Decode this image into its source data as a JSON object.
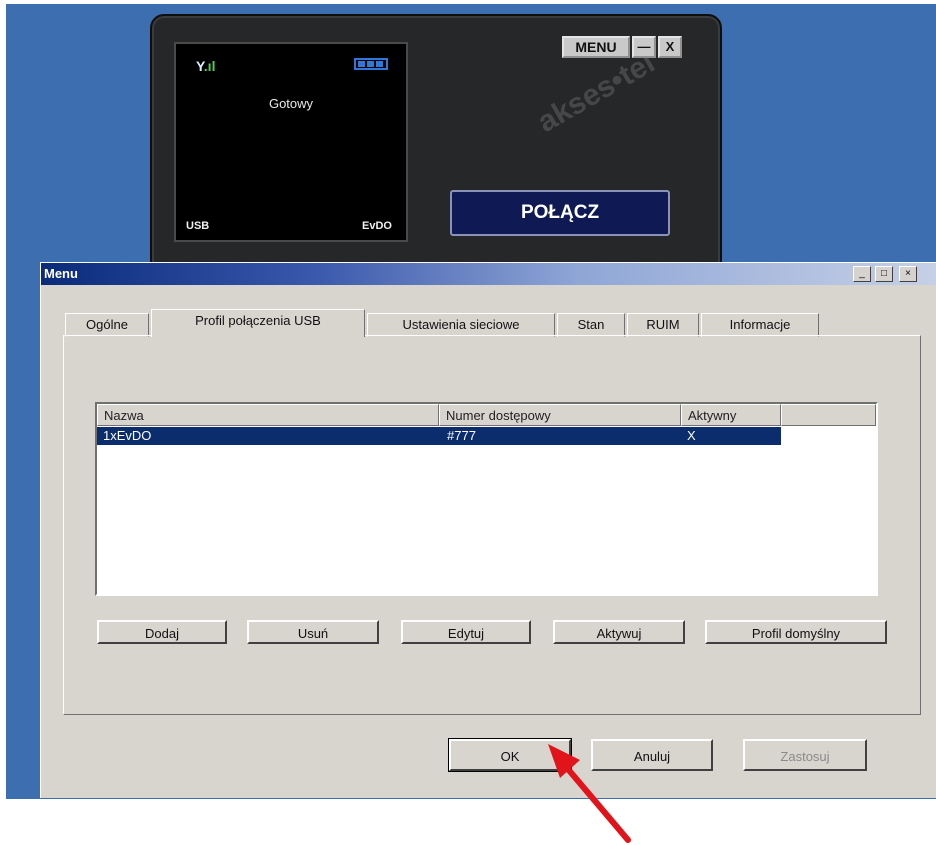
{
  "modem": {
    "signal_symbol": "Y",
    "signal_bars": ".ıl",
    "status": "Gotowy",
    "connection_type": "USB",
    "network": "EvDO",
    "menu_label": "MENU",
    "minimize_symbol": "—",
    "close_symbol": "X",
    "connect_label": "POŁĄCZ",
    "watermark": "akses•tel"
  },
  "dialog": {
    "title": "Menu",
    "window_controls": {
      "minimize": "_",
      "maximize": "□",
      "close": "×"
    },
    "tabs": [
      {
        "label": "Ogólne",
        "active": false
      },
      {
        "label": "Profil połączenia USB",
        "active": true
      },
      {
        "label": "Ustawienia sieciowe",
        "active": false
      },
      {
        "label": "Stan",
        "active": false
      },
      {
        "label": "RUIM",
        "active": false
      },
      {
        "label": "Informacje",
        "active": false
      }
    ],
    "table": {
      "columns": [
        "Nazwa",
        "Numer dostępowy",
        "Aktywny"
      ],
      "rows": [
        {
          "name": "1xEvDO",
          "number": "#777",
          "active": "X",
          "selected": true
        }
      ]
    },
    "panel_buttons": [
      "Dodaj",
      "Usuń",
      "Edytuj",
      "Aktywuj",
      "Profil domyślny"
    ],
    "dialog_buttons": {
      "ok": "OK",
      "cancel": "Anuluj",
      "apply": "Zastosuj"
    }
  },
  "colors": {
    "desktop": "#3d6eb0",
    "selection": "#0b2c6d",
    "arrow": "#e0141a"
  }
}
